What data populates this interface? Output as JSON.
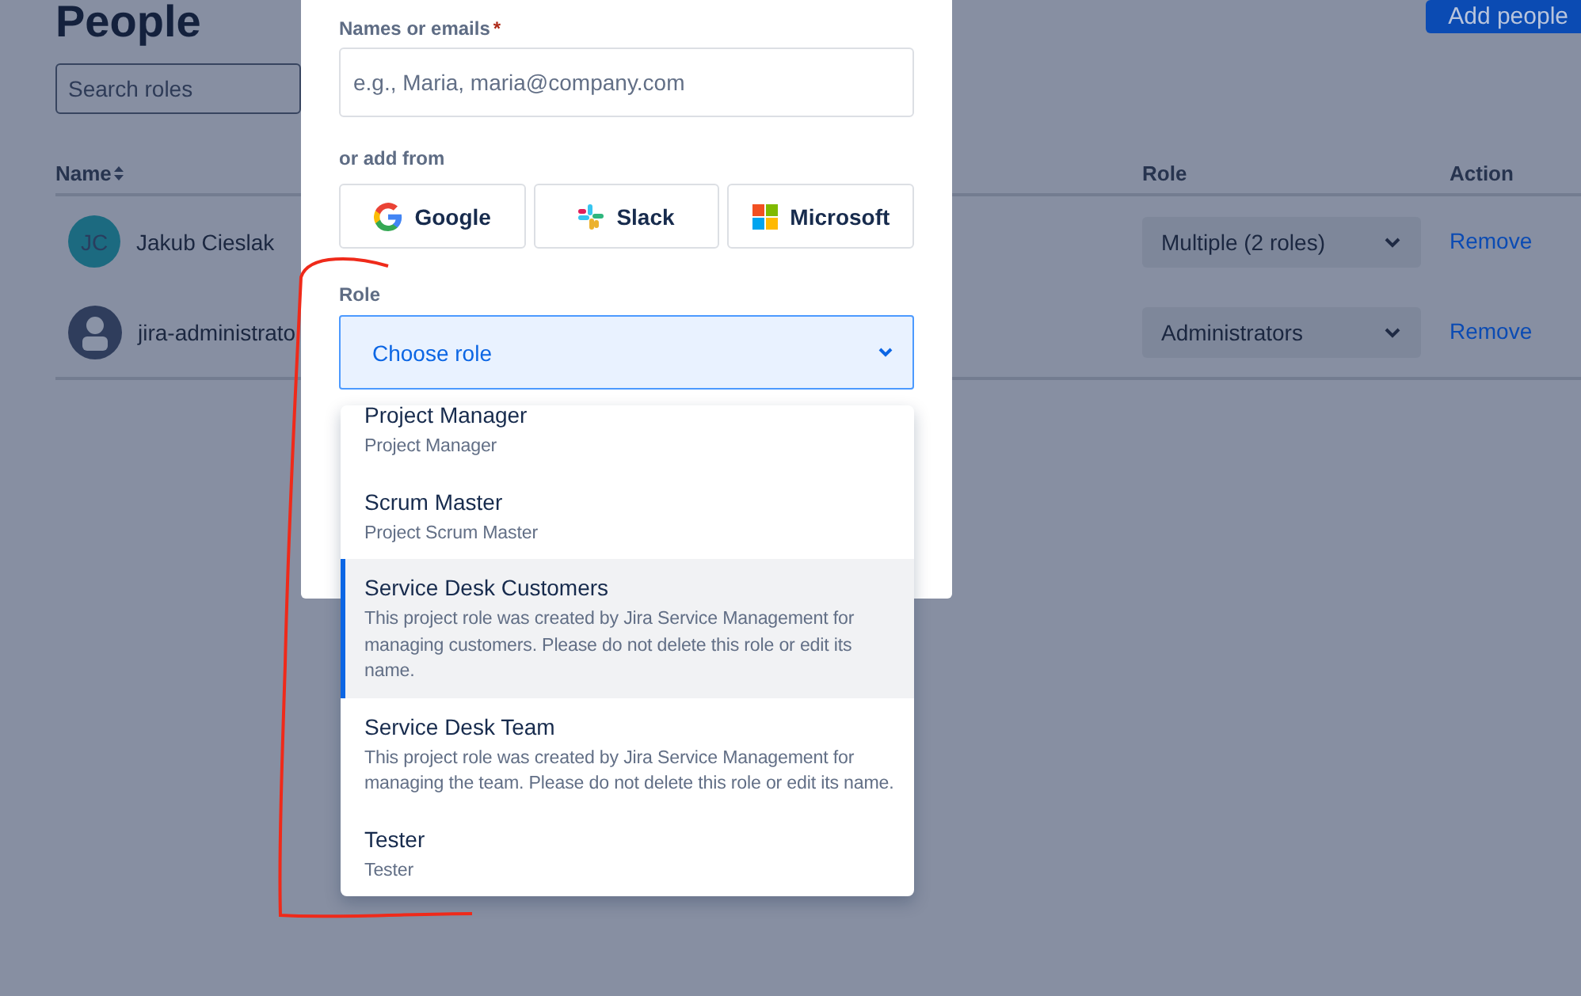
{
  "page": {
    "title": "People",
    "search": {
      "placeholder": "Search roles"
    },
    "add_button": "Add people"
  },
  "table": {
    "columns": [
      {
        "label": "Name",
        "sortable": true
      },
      {
        "label": "Role",
        "sortable": false
      },
      {
        "label": "Action",
        "sortable": false
      }
    ],
    "rows": [
      {
        "avatar": {
          "kind": "initials",
          "initials": "JC"
        },
        "name": "Jakub Cieslak",
        "role": "Multiple (2 roles)",
        "action": "Remove"
      },
      {
        "avatar": {
          "kind": "silhouette"
        },
        "name": "jira-administrato",
        "role": "Administrators",
        "action": "Remove"
      }
    ]
  },
  "modal": {
    "names_label": "Names or emails",
    "required_mark": "*",
    "names_placeholder": "e.g., Maria, maria@company.com",
    "add_from_label": "or add from",
    "providers": [
      {
        "kind": "google",
        "label": "Google"
      },
      {
        "kind": "slack",
        "label": "Slack"
      },
      {
        "kind": "microsoft",
        "label": "Microsoft"
      }
    ],
    "role_label": "Role",
    "role_select": {
      "placeholder": "Choose role",
      "expanded": true
    },
    "role_options": [
      {
        "title": "Project Manager",
        "description": "Project Manager",
        "selected": false
      },
      {
        "title": "Scrum Master",
        "description": "Project Scrum Master",
        "selected": false
      },
      {
        "title": "Service Desk Customers",
        "description": "This project role was created by Jira Service Management for managing customers. Please do not delete this role or edit its name.",
        "selected": true
      },
      {
        "title": "Service Desk Team",
        "description": "This project role was created by Jira Service Management for managing the team. Please do not delete this role or edit its name.",
        "selected": false
      },
      {
        "title": "Tester",
        "description": "Tester",
        "selected": false
      }
    ]
  }
}
